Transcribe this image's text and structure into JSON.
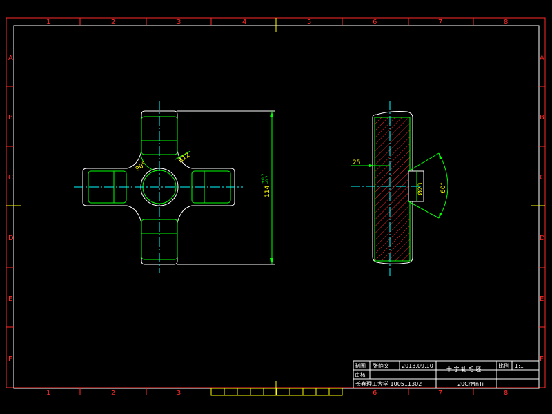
{
  "ruler": {
    "columns": [
      "1",
      "2",
      "3",
      "4",
      "5",
      "6",
      "7",
      "8"
    ],
    "rows": [
      "A",
      "B",
      "C",
      "D",
      "E",
      "F"
    ]
  },
  "dimensions": {
    "radius": "R12",
    "angle_left": "90°",
    "overall_height": "114",
    "tol_upper": "+0.2",
    "tol_lower": "-0.2",
    "offset_width": "25",
    "hole_diameter": "Ø23",
    "angle_right": "60°"
  },
  "title_block": {
    "drawn_label": "制图",
    "drawn_by": "张静文",
    "date": "2013.09.10",
    "title": "十 字 轴 毛 坯",
    "scale_label": "比例",
    "scale_value": "1:1",
    "checked_label": "审核",
    "school": "长春理工大学 100511302",
    "material": "20CrMnTi"
  },
  "colors": {
    "frame": "#ff2a2a",
    "outline": "#ffffff",
    "inner": "#00ff00",
    "center": "#00ffff",
    "dim": "#ffff00",
    "hatch": "#ff2a2a"
  }
}
